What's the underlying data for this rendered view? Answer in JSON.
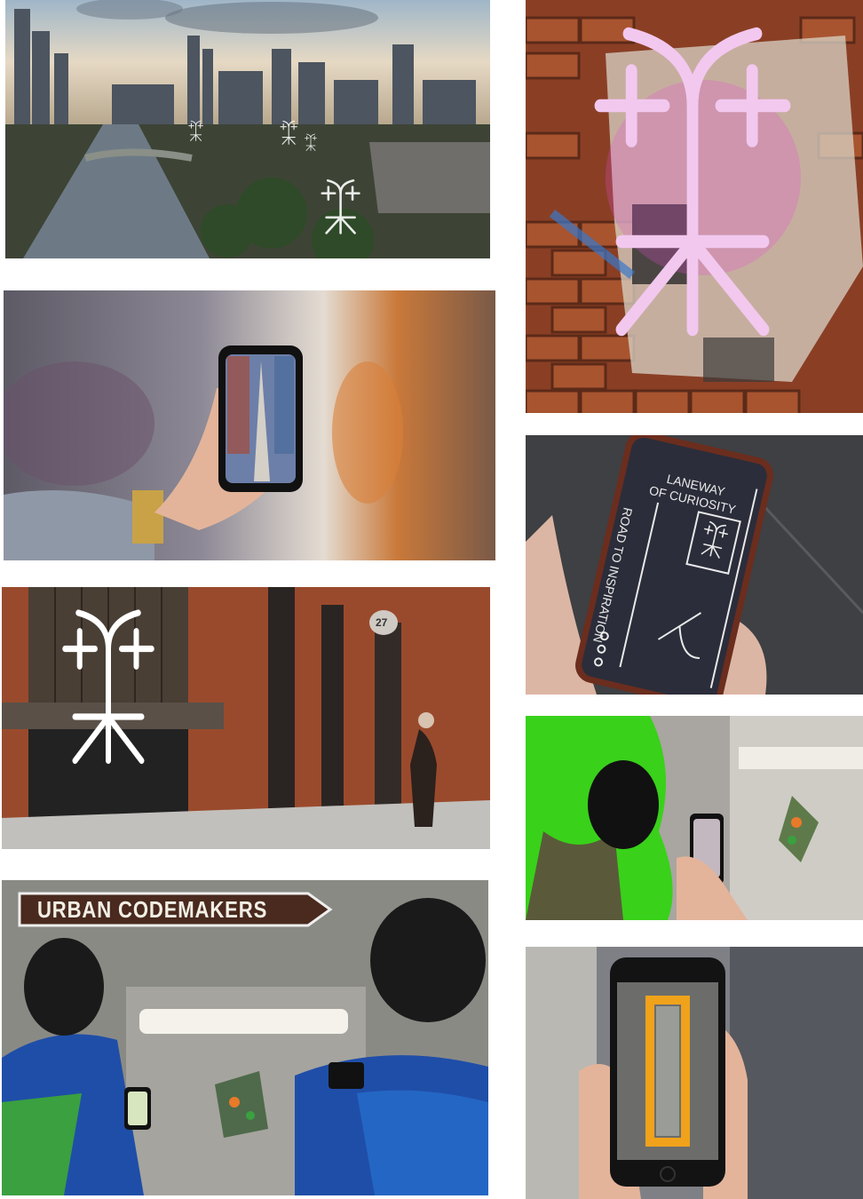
{
  "gallery": {
    "photos": [
      {
        "id": "city-aerial",
        "subject": "Aerial view of city skyline and river with glyph symbols overlaid"
      },
      {
        "id": "neon-glyph-wall",
        "subject": "Pink neon glyph on brick wall with torn posters"
      },
      {
        "id": "phone-laneway",
        "subject": "Hand holding a smartphone up in a blurred graffiti laneway"
      },
      {
        "id": "phone-laneway-of-curiosity",
        "subject": "Hand holding a phone displaying laneway app screen"
      },
      {
        "id": "brick-building-glyph",
        "subject": "Red brick building with large white glyph and man looking up"
      },
      {
        "id": "green-hair-headphones",
        "subject": "Person with green hair and headphones using phone near mosaic"
      },
      {
        "id": "urban-codemakers-sign",
        "subject": "Two people with headphones under Urban Codemakers street sign"
      },
      {
        "id": "phone-corridor-frame",
        "subject": "Hand holding phone showing an orange AR frame in a corridor"
      }
    ],
    "texts": {
      "phone_title_line1": "LANEWAY",
      "phone_title_line2": "OF CURIOSITY",
      "phone_vertical": "ROAD TO INSPIRATION",
      "street_sign": "URBAN CODEMAKERS",
      "door_number": "27"
    }
  },
  "colors": {
    "background": "#ffffff",
    "neon": "#f2c8ef",
    "brick": "#9a4a2c",
    "glyph_white": "#ffffff",
    "sign_brown": "#4a2a1e",
    "green_hair": "#39d11a",
    "ar_orange": "#f0a21a"
  }
}
